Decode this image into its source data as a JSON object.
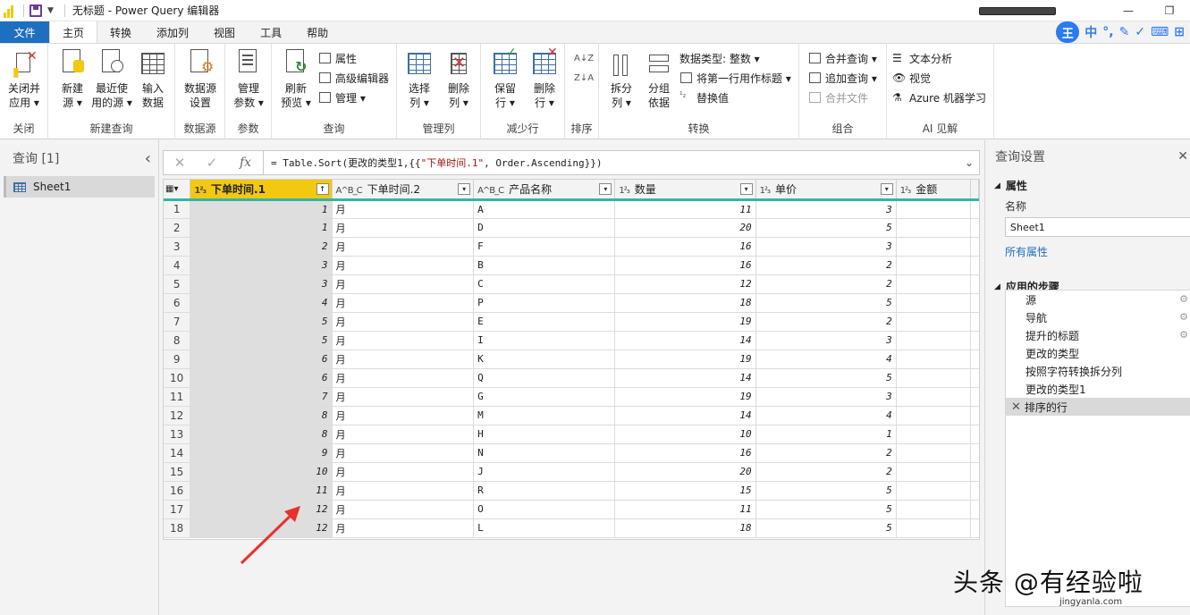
{
  "window": {
    "title": "无标题 - Power Query 编辑器",
    "minimize": "—",
    "restore": "❐"
  },
  "menu": {
    "file": "文件",
    "tabs": [
      "主页",
      "转换",
      "添加列",
      "视图",
      "工具",
      "帮助"
    ]
  },
  "ime": {
    "logo": "王",
    "items": [
      "中",
      "°,",
      "✎",
      "✓",
      "⌨",
      "⊞"
    ]
  },
  "ribbon": {
    "close_group": {
      "label": "关闭",
      "close_apply": "关闭并\n应用 ▾"
    },
    "new_query_group": {
      "label": "新建查询",
      "new_source": "新建\n源 ▾",
      "recent_sources": "最近使\n用的源 ▾",
      "enter_data": "输入\n数据"
    },
    "datasource_group": {
      "label": "数据源",
      "settings": "数据源\n设置"
    },
    "params_group": {
      "label": "参数",
      "manage": "管理\n参数 ▾"
    },
    "query_group": {
      "label": "查询",
      "refresh": "刷新\n预览 ▾",
      "properties": "属性",
      "advanced_editor": "高级编辑器",
      "manage": "管理 ▾"
    },
    "manage_cols_group": {
      "label": "管理列",
      "choose": "选择\n列 ▾",
      "remove": "删除\n列 ▾"
    },
    "reduce_rows_group": {
      "label": "减少行",
      "keep": "保留\n行 ▾",
      "remove": "删除\n行 ▾"
    },
    "sort_group": {
      "label": "排序",
      "asc": "A↓Z",
      "desc": "Z↓A"
    },
    "transform_group": {
      "label": "转换",
      "split": "拆分\n列 ▾",
      "group_by": "分组\n依据",
      "data_type": "数据类型: 整数 ▾",
      "first_row_header": "将第一行用作标题 ▾",
      "replace": "替换值"
    },
    "combine_group": {
      "label": "组合",
      "merge": "合并查询 ▾",
      "append": "追加查询 ▾",
      "combine_files": "合并文件"
    },
    "ai_group": {
      "label": "AI 见解",
      "text_analytics": "文本分析",
      "vision": "视觉",
      "azure_ml": "Azure 机器学习"
    }
  },
  "left_panel": {
    "header": "查询 [1]",
    "collapse": "‹",
    "queries": [
      "Sheet1"
    ]
  },
  "formula_bar": {
    "cancel": "✕",
    "commit": "✓",
    "fx": "fx",
    "prefix": "= Table.Sort(更改的类型1,{{",
    "string": "\"下单时间.1\"",
    "suffix": ", Order.Ascending}})",
    "expand": "⌄"
  },
  "table": {
    "columns": [
      {
        "type": "1²₃",
        "name": "下单时间.1",
        "selected": true
      },
      {
        "type": "A^B_C",
        "name": "下单时间.2"
      },
      {
        "type": "A^B_C",
        "name": "产品名称"
      },
      {
        "type": "1²₃",
        "name": "数量"
      },
      {
        "type": "1²₃",
        "name": "单价"
      },
      {
        "type": "1²₃",
        "name": "金额"
      }
    ],
    "rows": [
      [
        "1",
        "月",
        "A",
        "11",
        "3",
        ""
      ],
      [
        "1",
        "月",
        "D",
        "20",
        "5",
        ""
      ],
      [
        "2",
        "月",
        "F",
        "16",
        "3",
        ""
      ],
      [
        "3",
        "月",
        "B",
        "16",
        "2",
        ""
      ],
      [
        "3",
        "月",
        "C",
        "12",
        "2",
        ""
      ],
      [
        "4",
        "月",
        "P",
        "18",
        "5",
        ""
      ],
      [
        "5",
        "月",
        "E",
        "19",
        "2",
        ""
      ],
      [
        "5",
        "月",
        "I",
        "14",
        "3",
        ""
      ],
      [
        "6",
        "月",
        "K",
        "19",
        "4",
        ""
      ],
      [
        "6",
        "月",
        "Q",
        "14",
        "5",
        ""
      ],
      [
        "7",
        "月",
        "G",
        "19",
        "3",
        ""
      ],
      [
        "8",
        "月",
        "M",
        "14",
        "4",
        ""
      ],
      [
        "8",
        "月",
        "H",
        "10",
        "1",
        ""
      ],
      [
        "9",
        "月",
        "N",
        "16",
        "2",
        ""
      ],
      [
        "10",
        "月",
        "J",
        "20",
        "2",
        ""
      ],
      [
        "11",
        "月",
        "R",
        "15",
        "5",
        ""
      ],
      [
        "12",
        "月",
        "O",
        "11",
        "5",
        ""
      ],
      [
        "12",
        "月",
        "L",
        "18",
        "5",
        ""
      ]
    ]
  },
  "right_panel": {
    "header": "查询设置",
    "close": "✕",
    "properties_section": "属性",
    "name_label": "名称",
    "name_value": "Sheet1",
    "all_properties": "所有属性",
    "steps_section": "应用的步骤",
    "steps": [
      {
        "name": "源",
        "gear": true
      },
      {
        "name": "导航",
        "gear": true
      },
      {
        "name": "提升的标题",
        "gear": true
      },
      {
        "name": "更改的类型",
        "gear": false
      },
      {
        "name": "按照字符转换拆分列",
        "gear": false
      },
      {
        "name": "更改的类型1",
        "gear": false
      },
      {
        "name": "排序的行",
        "gear": false,
        "active": true
      }
    ]
  },
  "watermark": {
    "text": "头条 @有经验啦",
    "site": "jingyanla.com"
  },
  "colors": {
    "accent": "#1e6fbf",
    "selected_col": "#f2c811",
    "quality_bar": "#33b5a5",
    "arrow": "#e8312f"
  }
}
